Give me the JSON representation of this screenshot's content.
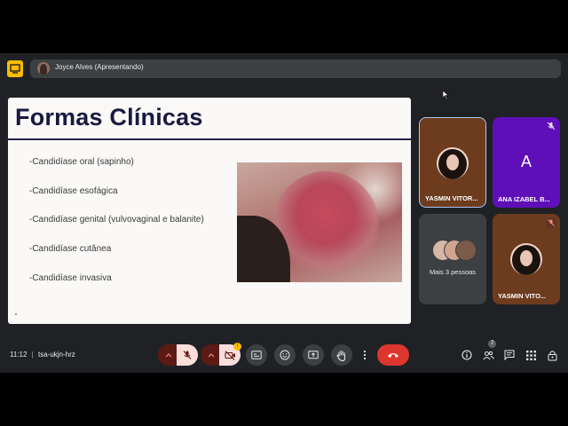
{
  "presenting": {
    "label": "Joyce Alves (Apresentando)"
  },
  "slide": {
    "title": "Formas Clínicas",
    "bullets": [
      "-Candidíase oral (sapinho)",
      "-Candidíase esofágica",
      "-Candidíase genital (vulvovaginal e balanite)",
      "-Candidíase cutânea",
      "-Candidíase invasiva"
    ]
  },
  "participants": [
    {
      "name": "YASMIN VITOR...",
      "mic_muted": false,
      "active": true
    },
    {
      "name": "ANA IZABEL B...",
      "initial": "A",
      "mic_muted": true
    },
    {
      "name": "Mais 3 pessoas"
    },
    {
      "name": "YASMIN VITO...",
      "mic_muted": true
    }
  ],
  "bottom_bar": {
    "time": "11:12",
    "meeting_code": "tsa-ukjn-hrz",
    "camera_badge": "!",
    "people_count": "7"
  },
  "colors": {
    "background": "#202124",
    "accent_yellow": "#fbbc04",
    "end_call_red": "#dc362e",
    "ana_tile": "#5f0fb7"
  }
}
